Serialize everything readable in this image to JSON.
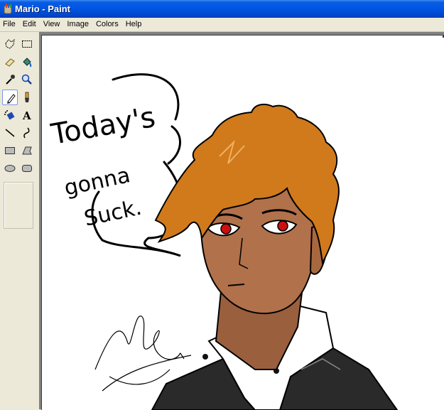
{
  "window": {
    "title": "Mario - Paint"
  },
  "menu": {
    "items": [
      "File",
      "Edit",
      "View",
      "Image",
      "Colors",
      "Help"
    ]
  },
  "toolbox": {
    "tools": [
      {
        "name": "free-form-select-icon"
      },
      {
        "name": "rectangle-select-icon"
      },
      {
        "name": "eraser-icon"
      },
      {
        "name": "fill-bucket-icon"
      },
      {
        "name": "pick-color-icon"
      },
      {
        "name": "magnifier-icon"
      },
      {
        "name": "pencil-icon",
        "active": true
      },
      {
        "name": "brush-icon"
      },
      {
        "name": "airbrush-icon"
      },
      {
        "name": "text-tool-icon",
        "glyph": "A"
      },
      {
        "name": "line-icon"
      },
      {
        "name": "curve-icon"
      },
      {
        "name": "rectangle-icon"
      },
      {
        "name": "polygon-icon"
      },
      {
        "name": "ellipse-icon"
      },
      {
        "name": "rounded-rectangle-icon"
      }
    ]
  },
  "canvas": {
    "speech_bubble_text": [
      "Today's",
      "gonna",
      "Suck."
    ],
    "colors": {
      "hair": "#d07a1c",
      "skin": "#b0714b",
      "eyes": "#cc1010",
      "shirt": "#ffffff",
      "vest": "#2a2a2a"
    }
  }
}
